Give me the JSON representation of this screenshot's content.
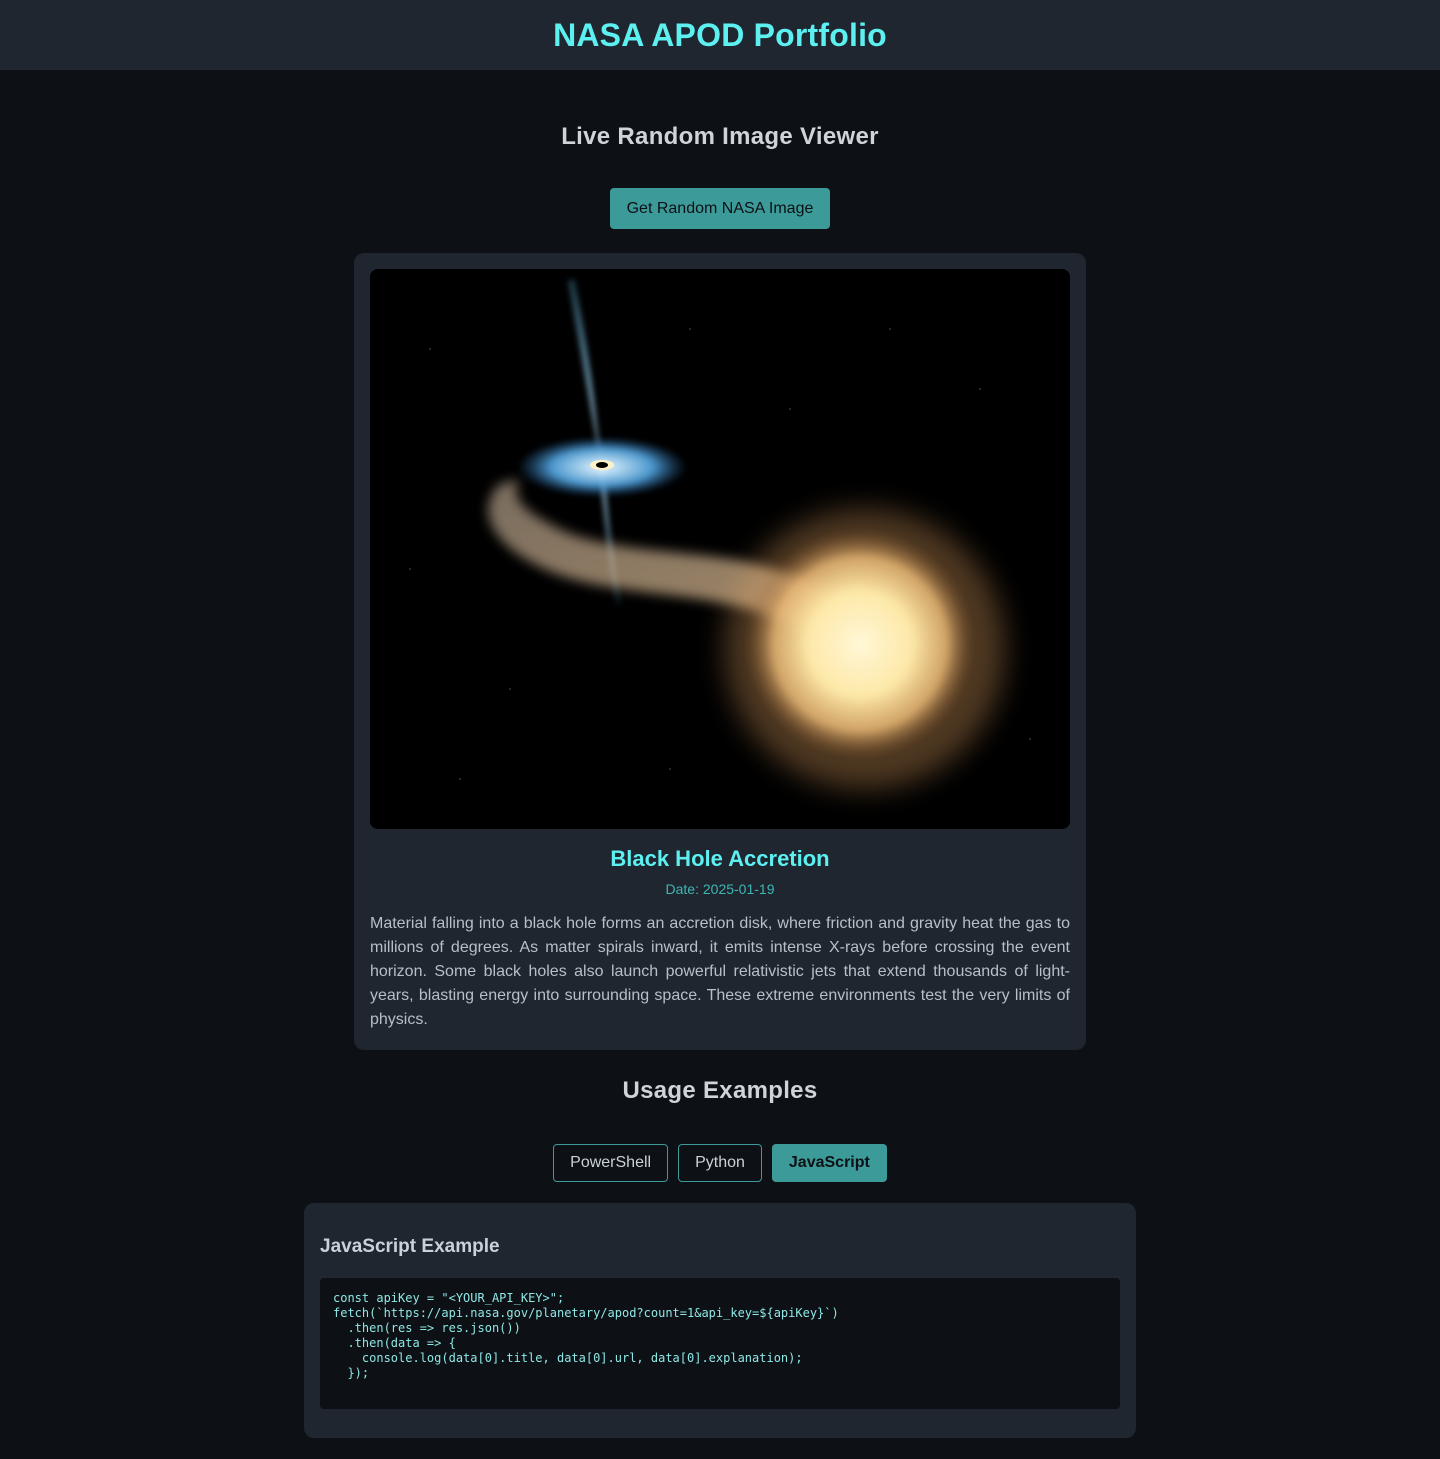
{
  "header": {
    "title": "NASA APOD Portfolio"
  },
  "viewer": {
    "section_title": "Live Random Image Viewer",
    "button_label": "Get Random NASA Image",
    "apod": {
      "title": "Black Hole Accretion",
      "date": "Date: 2025-01-19",
      "description": "Material falling into a black hole forms an accretion disk, where friction and gravity heat the gas to millions of degrees. As matter spirals inward, it emits intense X-rays before crossing the event horizon. Some black holes also launch powerful relativistic jets that extend thousands of light-years, blasting energy into surrounding space. These extreme environments test the very limits of physics."
    }
  },
  "usage": {
    "section_title": "Usage Examples",
    "tabs": [
      {
        "label": "PowerShell",
        "active": false
      },
      {
        "label": "Python",
        "active": false
      },
      {
        "label": "JavaScript",
        "active": true
      }
    ],
    "example": {
      "title": "JavaScript Example",
      "code": "const apiKey = \"<YOUR_API_KEY>\";\nfetch(`https://api.nasa.gov/planetary/apod?count=1&api_key=${apiKey}`)\n  .then(res => res.json())\n  .then(data => {\n    console.log(data[0].title, data[0].url, data[0].explanation);\n  });"
    }
  },
  "colors": {
    "accent": "#5cf0f0",
    "button": "#3c9a99",
    "background": "#0d1014",
    "card": "#1f2630"
  }
}
